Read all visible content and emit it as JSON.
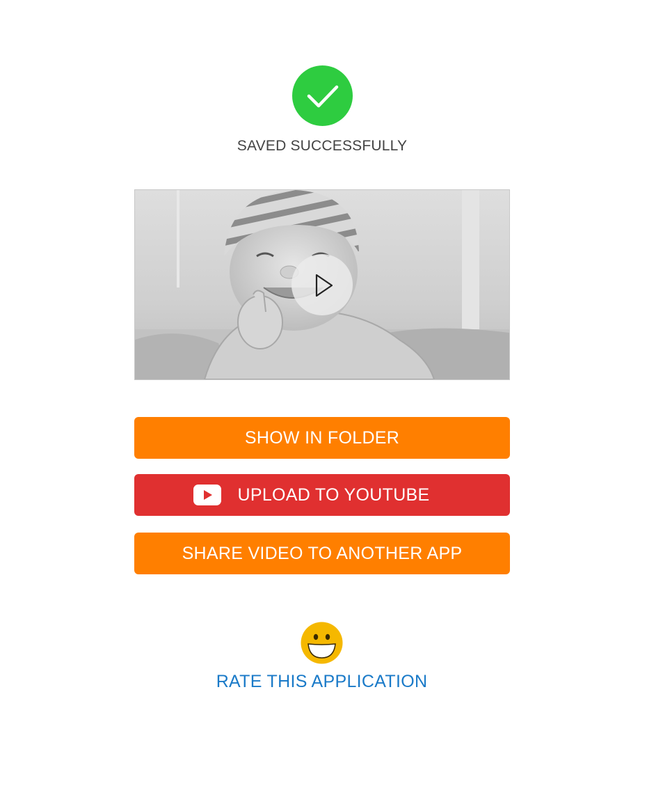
{
  "status": {
    "icon": "checkmark-circle-icon",
    "message": "SAVED SUCCESSFULLY",
    "color": "#2ecc40"
  },
  "preview": {
    "thumbnail": "baby-photo-thumbnail",
    "play_icon": "play-icon"
  },
  "actions": {
    "show_in_folder": "SHOW IN FOLDER",
    "upload_youtube": "UPLOAD TO YOUTUBE",
    "share": "SHARE VIDEO TO ANOTHER APP",
    "orange": "#ff7f00",
    "red": "#e03030"
  },
  "rate": {
    "icon": "smiley-icon",
    "label": "RATE THIS APPLICATION",
    "color": "#1a7ac8"
  }
}
